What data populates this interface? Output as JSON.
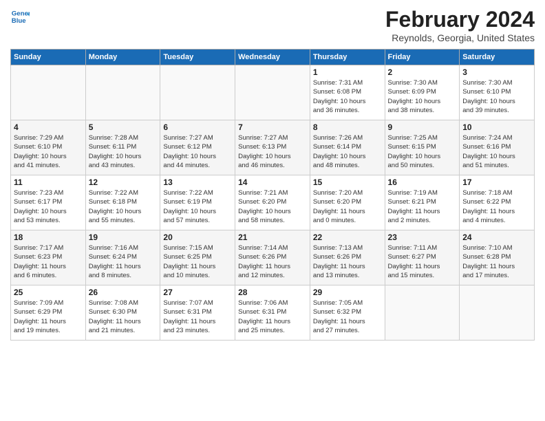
{
  "header": {
    "logo_line1": "General",
    "logo_line2": "Blue",
    "title": "February 2024",
    "subtitle": "Reynolds, Georgia, United States"
  },
  "calendar": {
    "days_of_week": [
      "Sunday",
      "Monday",
      "Tuesday",
      "Wednesday",
      "Thursday",
      "Friday",
      "Saturday"
    ],
    "weeks": [
      [
        {
          "day": "",
          "info": ""
        },
        {
          "day": "",
          "info": ""
        },
        {
          "day": "",
          "info": ""
        },
        {
          "day": "",
          "info": ""
        },
        {
          "day": "1",
          "info": "Sunrise: 7:31 AM\nSunset: 6:08 PM\nDaylight: 10 hours\nand 36 minutes."
        },
        {
          "day": "2",
          "info": "Sunrise: 7:30 AM\nSunset: 6:09 PM\nDaylight: 10 hours\nand 38 minutes."
        },
        {
          "day": "3",
          "info": "Sunrise: 7:30 AM\nSunset: 6:10 PM\nDaylight: 10 hours\nand 39 minutes."
        }
      ],
      [
        {
          "day": "4",
          "info": "Sunrise: 7:29 AM\nSunset: 6:10 PM\nDaylight: 10 hours\nand 41 minutes."
        },
        {
          "day": "5",
          "info": "Sunrise: 7:28 AM\nSunset: 6:11 PM\nDaylight: 10 hours\nand 43 minutes."
        },
        {
          "day": "6",
          "info": "Sunrise: 7:27 AM\nSunset: 6:12 PM\nDaylight: 10 hours\nand 44 minutes."
        },
        {
          "day": "7",
          "info": "Sunrise: 7:27 AM\nSunset: 6:13 PM\nDaylight: 10 hours\nand 46 minutes."
        },
        {
          "day": "8",
          "info": "Sunrise: 7:26 AM\nSunset: 6:14 PM\nDaylight: 10 hours\nand 48 minutes."
        },
        {
          "day": "9",
          "info": "Sunrise: 7:25 AM\nSunset: 6:15 PM\nDaylight: 10 hours\nand 50 minutes."
        },
        {
          "day": "10",
          "info": "Sunrise: 7:24 AM\nSunset: 6:16 PM\nDaylight: 10 hours\nand 51 minutes."
        }
      ],
      [
        {
          "day": "11",
          "info": "Sunrise: 7:23 AM\nSunset: 6:17 PM\nDaylight: 10 hours\nand 53 minutes."
        },
        {
          "day": "12",
          "info": "Sunrise: 7:22 AM\nSunset: 6:18 PM\nDaylight: 10 hours\nand 55 minutes."
        },
        {
          "day": "13",
          "info": "Sunrise: 7:22 AM\nSunset: 6:19 PM\nDaylight: 10 hours\nand 57 minutes."
        },
        {
          "day": "14",
          "info": "Sunrise: 7:21 AM\nSunset: 6:20 PM\nDaylight: 10 hours\nand 58 minutes."
        },
        {
          "day": "15",
          "info": "Sunrise: 7:20 AM\nSunset: 6:20 PM\nDaylight: 11 hours\nand 0 minutes."
        },
        {
          "day": "16",
          "info": "Sunrise: 7:19 AM\nSunset: 6:21 PM\nDaylight: 11 hours\nand 2 minutes."
        },
        {
          "day": "17",
          "info": "Sunrise: 7:18 AM\nSunset: 6:22 PM\nDaylight: 11 hours\nand 4 minutes."
        }
      ],
      [
        {
          "day": "18",
          "info": "Sunrise: 7:17 AM\nSunset: 6:23 PM\nDaylight: 11 hours\nand 6 minutes."
        },
        {
          "day": "19",
          "info": "Sunrise: 7:16 AM\nSunset: 6:24 PM\nDaylight: 11 hours\nand 8 minutes."
        },
        {
          "day": "20",
          "info": "Sunrise: 7:15 AM\nSunset: 6:25 PM\nDaylight: 11 hours\nand 10 minutes."
        },
        {
          "day": "21",
          "info": "Sunrise: 7:14 AM\nSunset: 6:26 PM\nDaylight: 11 hours\nand 12 minutes."
        },
        {
          "day": "22",
          "info": "Sunrise: 7:13 AM\nSunset: 6:26 PM\nDaylight: 11 hours\nand 13 minutes."
        },
        {
          "day": "23",
          "info": "Sunrise: 7:11 AM\nSunset: 6:27 PM\nDaylight: 11 hours\nand 15 minutes."
        },
        {
          "day": "24",
          "info": "Sunrise: 7:10 AM\nSunset: 6:28 PM\nDaylight: 11 hours\nand 17 minutes."
        }
      ],
      [
        {
          "day": "25",
          "info": "Sunrise: 7:09 AM\nSunset: 6:29 PM\nDaylight: 11 hours\nand 19 minutes."
        },
        {
          "day": "26",
          "info": "Sunrise: 7:08 AM\nSunset: 6:30 PM\nDaylight: 11 hours\nand 21 minutes."
        },
        {
          "day": "27",
          "info": "Sunrise: 7:07 AM\nSunset: 6:31 PM\nDaylight: 11 hours\nand 23 minutes."
        },
        {
          "day": "28",
          "info": "Sunrise: 7:06 AM\nSunset: 6:31 PM\nDaylight: 11 hours\nand 25 minutes."
        },
        {
          "day": "29",
          "info": "Sunrise: 7:05 AM\nSunset: 6:32 PM\nDaylight: 11 hours\nand 27 minutes."
        },
        {
          "day": "",
          "info": ""
        },
        {
          "day": "",
          "info": ""
        }
      ]
    ]
  }
}
